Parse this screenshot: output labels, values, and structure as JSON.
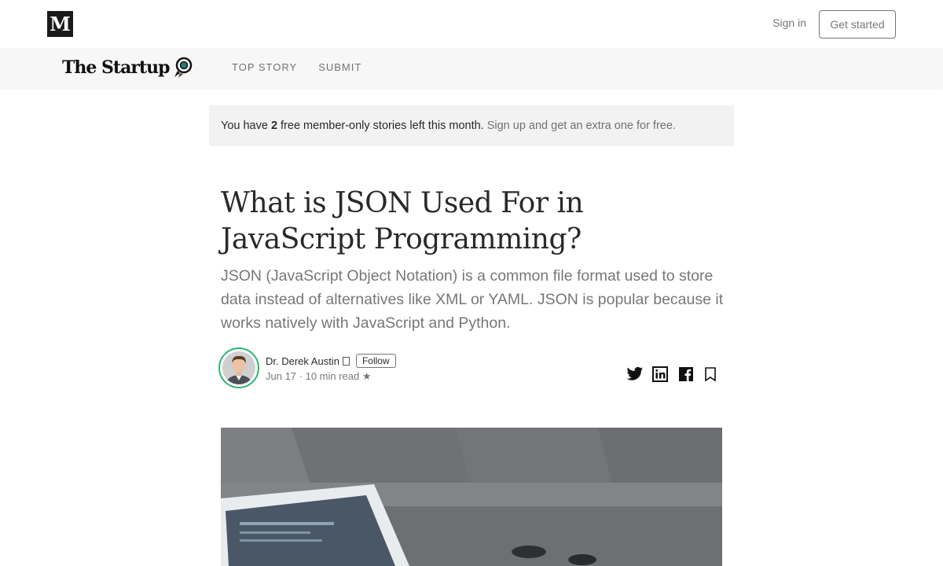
{
  "topbar": {
    "logo_letter": "M",
    "signin_label": "Sign in",
    "get_started_label": "Get started"
  },
  "publication": {
    "name": "The Startup",
    "nav": [
      "TOP STORY",
      "SUBMIT"
    ]
  },
  "meter": {
    "prefix": "You have",
    "count": "2",
    "suffix": "free member-only stories left this month.",
    "cta": "Sign up and get an extra one for free."
  },
  "article": {
    "title": "What is JSON Used For in JavaScript Programming?",
    "subtitle": "JSON (JavaScript Object Notation) is a common file format used to store data instead of alternatives like XML or YAML. JSON is popular because it works natively with JavaScript and Python.",
    "author": "Dr. Derek Austin",
    "follow_label": "Follow",
    "meta": "Jun 17 · 10 min read ★"
  },
  "colors": {
    "accent_ring": "#2bb673",
    "banner_bg": "#f2f2f2",
    "pubbar_bg": "#f7f7f7"
  },
  "icons": [
    "twitter-icon",
    "linkedin-icon",
    "facebook-icon",
    "bookmark-icon"
  ]
}
